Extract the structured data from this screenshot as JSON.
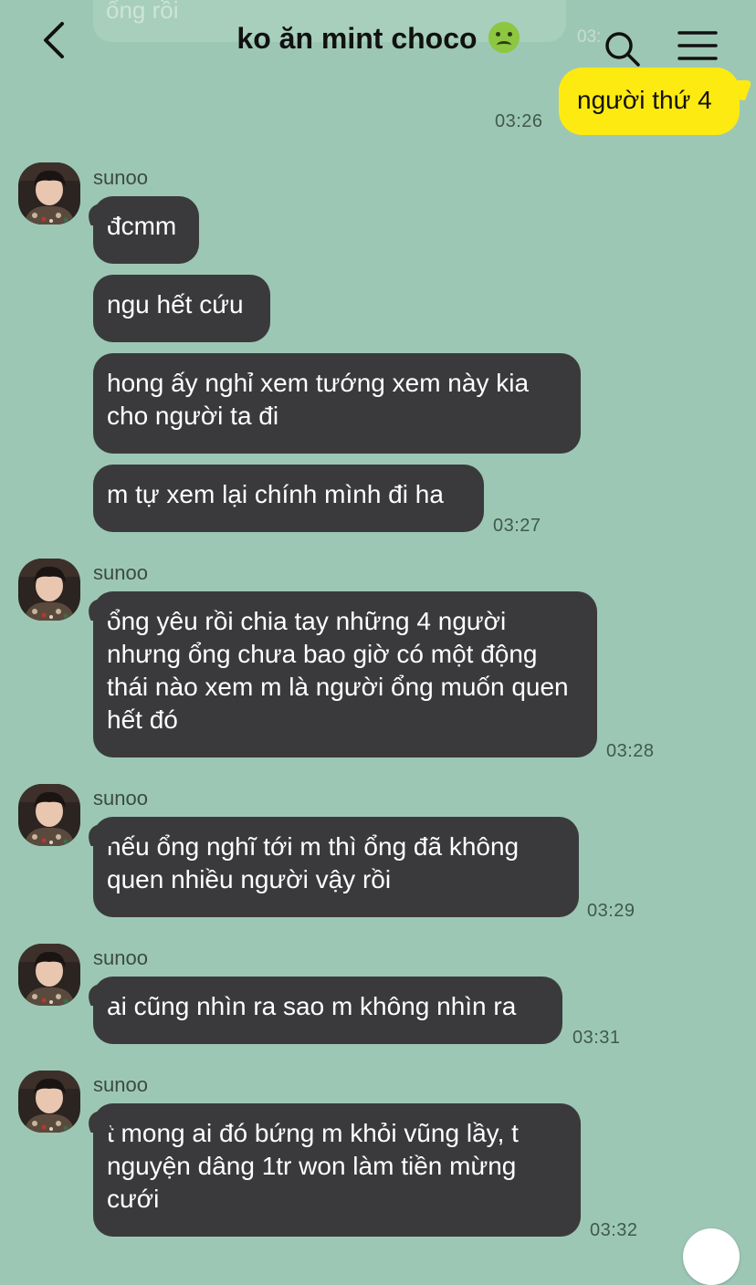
{
  "header": {
    "title": "ko ăn mint choco",
    "back_icon": "chevron-left-icon",
    "search_icon": "search-icon",
    "menu_icon": "menu-icon",
    "title_emoji": "nauseated-face-emoji"
  },
  "partial_previous": {
    "text": "ổng rồi",
    "time": "03:"
  },
  "outgoing": {
    "text": "người thứ 4",
    "time": "03:26"
  },
  "messages": [
    {
      "sender": "sunoo",
      "bubbles": [
        "đcmm",
        "ngu hết cứu",
        "hong ấy nghỉ xem tướng xem này kia cho người ta đi",
        "m tự xem lại chính mình đi ha"
      ],
      "time": "03:27"
    },
    {
      "sender": "sunoo",
      "bubbles": [
        "ổng yêu rồi chia tay những 4 người nhưng ổng chưa bao giờ có một động thái nào xem m là người ổng muốn quen hết đó"
      ],
      "time": "03:28"
    },
    {
      "sender": "sunoo",
      "bubbles": [
        "nếu ổng nghĩ tới m thì ổng đã không quen nhiều người vậy rồi"
      ],
      "time": "03:29"
    },
    {
      "sender": "sunoo",
      "bubbles": [
        "ai cũng nhìn ra sao m không nhìn ra"
      ],
      "time": "03:31"
    },
    {
      "sender": "sunoo",
      "bubbles": [
        "t mong ai đó bứng m khỏi vũng lầy, t nguyện dâng 1tr won làm tiền mừng cưới"
      ],
      "time": "03:32"
    }
  ],
  "colors": {
    "background": "#9dc7b5",
    "outgoing_bubble": "#fdea11",
    "incoming_bubble": "#3a3a3c"
  }
}
